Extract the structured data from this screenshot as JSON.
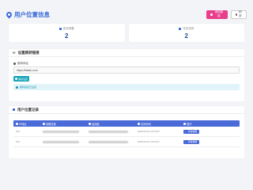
{
  "header": {
    "title": "用户位置信息",
    "buttons": {
      "primary_label": "添加链接",
      "secondary_label": "刷新"
    }
  },
  "stats": [
    {
      "label": "总访问数",
      "value": "2"
    },
    {
      "label": "今日访问",
      "value": "2"
    }
  ],
  "config": {
    "title": "设置跳转链接",
    "field_label": "跳转网址",
    "url": "https://baidu.com",
    "save_label": "保存设置",
    "tip": "跳转链接已设置"
  },
  "records": {
    "title": "用户位置记录",
    "columns": [
      "IP地址",
      "地理位置",
      "经纬度",
      "访问时间",
      "操作"
    ],
    "rows": [
      {
        "ip": "221.",
        "time": "2025-03-16 15:34:07",
        "action": "查看地图"
      },
      {
        "ip": "221.",
        "time": "2025-03-16 15:34:07",
        "action": "查看地图"
      }
    ]
  },
  "colors": {
    "accent": "#3a6cd8",
    "pink": "#e83e8c",
    "teal": "#17a2b8",
    "table_head": "#4a6ad8"
  }
}
